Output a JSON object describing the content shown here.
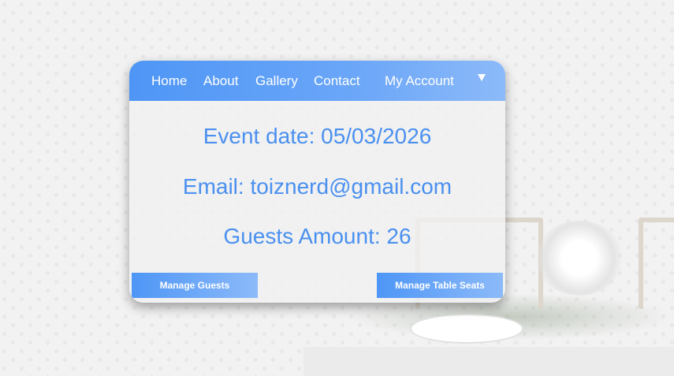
{
  "nav": {
    "items": [
      "Home",
      "About",
      "Gallery",
      "Contact",
      "My Account"
    ],
    "dropdown_icon": "triangle-down"
  },
  "event": {
    "date_line": "Event date: 05/03/2026",
    "email_line": "Email: toiznerd@gmail.com",
    "guests_line": "Guests Amount: 26"
  },
  "buttons": {
    "manage_guests": "Manage Guests",
    "manage_table_seats": "Manage Table Seats"
  },
  "colors": {
    "accent": "#4a90f0",
    "nav_gradient_start": "#4e96f6",
    "nav_gradient_end": "#8cbaf9"
  }
}
